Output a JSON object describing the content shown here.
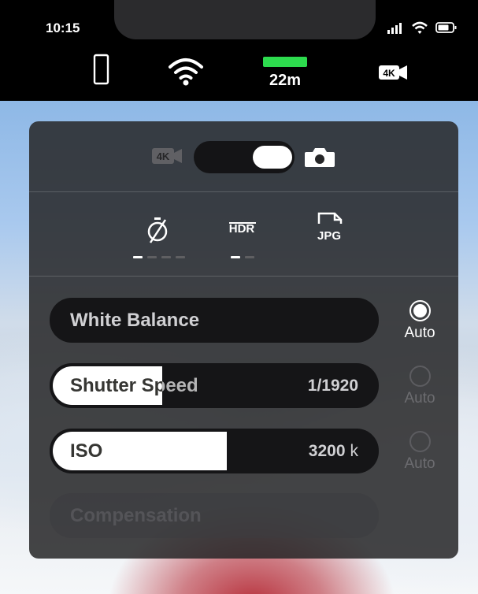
{
  "status_bar": {
    "time": "10:15"
  },
  "camera_status": {
    "storage_remaining": "22m",
    "battery_color": "#2ddb4e",
    "icons": [
      "phone-icon",
      "wifi-icon",
      "battery-icon",
      "4k-video-icon"
    ]
  },
  "mode": {
    "active": "photo",
    "left_icon": "4k-video-icon",
    "right_icon": "camera-icon"
  },
  "quick_settings": [
    {
      "icon": "timer-off-icon",
      "dots_total": 4,
      "dots_active": 1
    },
    {
      "icon": "hdr-off-icon",
      "dots_total": 2,
      "dots_active": 1
    },
    {
      "icon": "jpg-format-icon",
      "label": "JPG"
    }
  ],
  "controls": {
    "white_balance": {
      "label": "White Balance",
      "auto_label": "Auto",
      "auto": true
    },
    "shutter_speed": {
      "label": "Shutter Speed",
      "value": "1/1920",
      "level": 0.34,
      "auto_label": "Auto",
      "auto": false
    },
    "iso": {
      "label": "ISO",
      "value": "3200",
      "unit": "k",
      "level": 0.54,
      "auto_label": "Auto",
      "auto": false
    },
    "compensation": {
      "label": "Compensation",
      "disabled": true
    }
  }
}
